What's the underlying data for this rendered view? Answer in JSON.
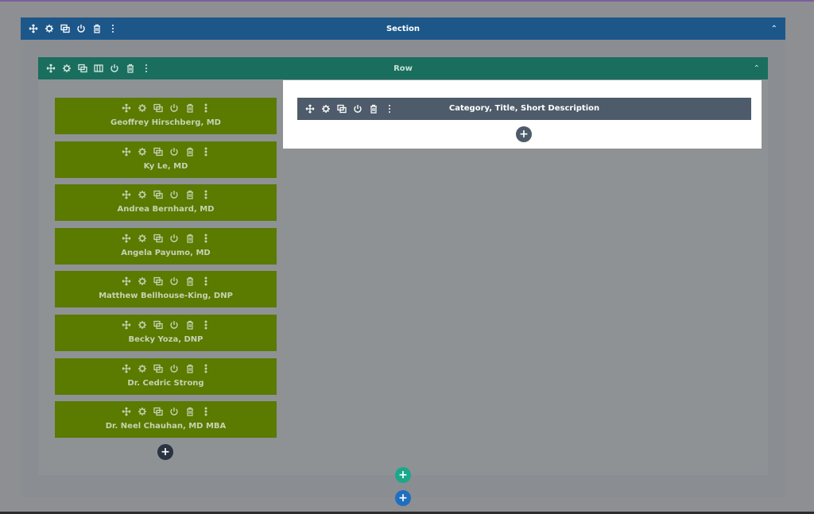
{
  "section": {
    "title": "Section"
  },
  "row": {
    "title": "Row"
  },
  "modules": [
    {
      "label": "Geoffrey Hirschberg, MD"
    },
    {
      "label": "Ky Le, MD"
    },
    {
      "label": "Andrea Bernhard, MD"
    },
    {
      "label": "Angela Payumo, MD"
    },
    {
      "label": "Matthew Bellhouse-King, DNP"
    },
    {
      "label": "Becky Yoza, DNP"
    },
    {
      "label": "Dr. Cedric Strong"
    },
    {
      "label": "Dr. Neel Chauhan, MD MBA"
    }
  ],
  "column2": {
    "module_label": "Category, Title, Short Description"
  },
  "add_symbol": "+",
  "colors": {
    "section_bar": "#1d578a",
    "row_bar": "#1a6e5e",
    "module": "#5a7a00",
    "module2": "#4d5b6a",
    "add_teal": "#1aa88a",
    "add_blue": "#1f6fbf"
  },
  "icons": [
    "move-icon",
    "gear-icon",
    "duplicate-icon",
    "columns-icon",
    "power-icon",
    "trash-icon",
    "more-icon"
  ]
}
